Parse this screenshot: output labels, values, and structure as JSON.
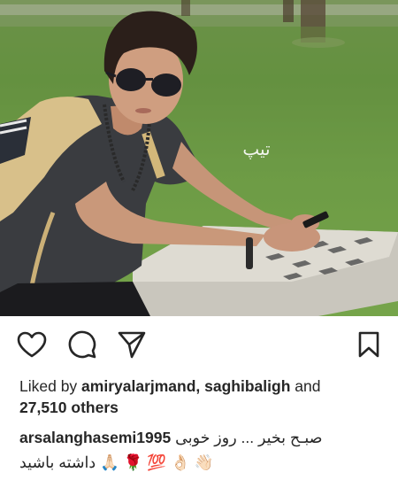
{
  "post": {
    "signature_text": "تیپ",
    "likes": {
      "prefix": "Liked by ",
      "user1": "amiryalarjmand",
      "separator": ", ",
      "user2": "saghibaligh",
      "and_text": " and",
      "others": "27,510 others"
    },
    "caption": {
      "username": "arsalanghasemi1995",
      "text_line1": "صبـح بخیر ... روز خوبی",
      "text_line2": "👋🏻 👌🏻 💯 🌹 🙏🏻 داشته باشید"
    }
  },
  "icons": {
    "like": "heart-icon",
    "comment": "comment-icon",
    "share": "send-icon",
    "save": "bookmark-icon"
  },
  "colors": {
    "text": "#262626",
    "background": "#ffffff"
  }
}
